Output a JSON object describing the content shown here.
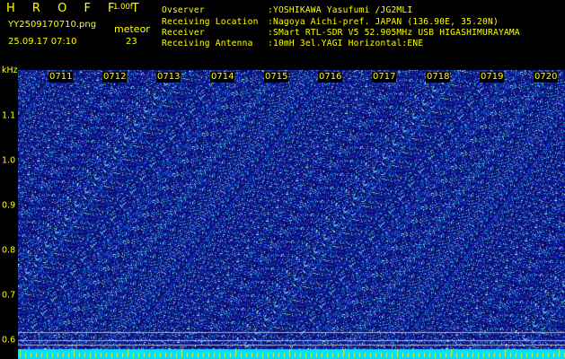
{
  "header": {
    "brand": "H R O F F T",
    "version": "1.00f",
    "filename": "YY2509170710.png",
    "datetime": "25.09.17 07:10",
    "meteor_label": "meteor",
    "meteor_count": "23"
  },
  "station_info": [
    {
      "key": "Ovserver",
      "value": ":YOSHIKAWA Yasufumi /JG2MLI"
    },
    {
      "key": "Receiving Location",
      "value": ":Nagoya Aichi-pref. JAPAN (136.90E, 35.20N)"
    },
    {
      "key": "Receiver",
      "value": ":SMart RTL-SDR V5 52.905MHz USB HIGASHIMURAYAMA"
    },
    {
      "key": "Receiving Antenna",
      "value": ":10mH 3el.YAGI Horizontal:ENE"
    }
  ],
  "freq_axis": {
    "unit": "kHz",
    "ticks": [
      "1.1",
      "1.0",
      "0.9",
      "0.8",
      "0.7",
      "0.6"
    ]
  },
  "time_axis": {
    "ticks": [
      "0711",
      "0712",
      "0713",
      "0714",
      "0715",
      "0716",
      "0717",
      "0718",
      "0719",
      "0720"
    ]
  },
  "colors": {
    "text": "#ffff00",
    "background": "#000000",
    "spectrogram_noise": "#10107a",
    "baseline": "#00e0ff"
  }
}
